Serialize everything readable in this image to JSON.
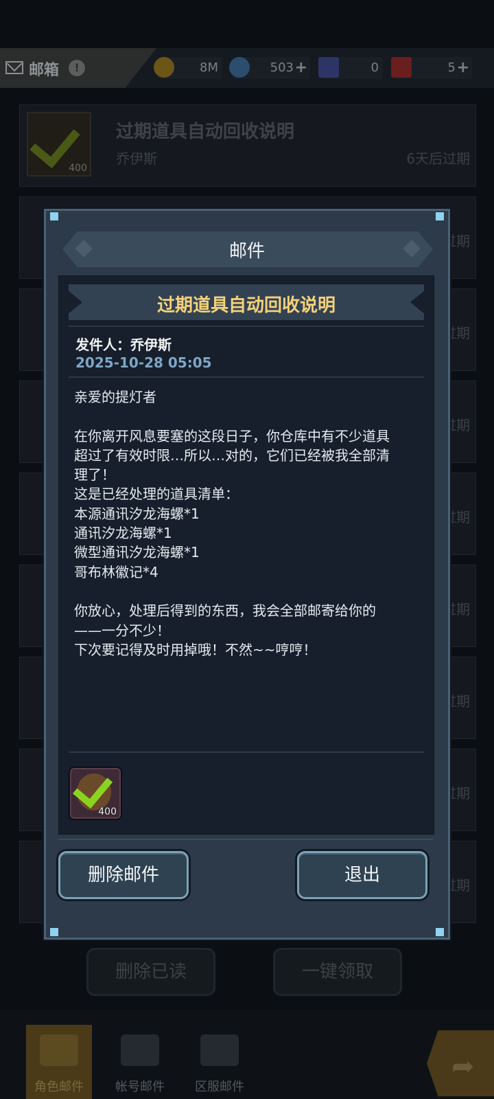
{
  "topbar": {
    "title": "邮箱",
    "help": "!",
    "resources": [
      {
        "icon": "gold-coin-icon",
        "value": "8M"
      },
      {
        "icon": "crystal-icon",
        "value": "503"
      },
      {
        "icon": "ticket-blue-icon",
        "value": "0"
      },
      {
        "icon": "ticket-red-icon",
        "value": "5"
      }
    ],
    "plus": "+"
  },
  "mail_list": [
    {
      "subject": "过期道具自动回收说明",
      "sender": "乔伊斯",
      "expire": "6天后过期",
      "qty": "400"
    },
    {
      "expire": "过期"
    },
    {
      "expire": "过期"
    },
    {
      "expire": "过期"
    },
    {
      "expire": "过期"
    },
    {
      "expire": "过期"
    },
    {
      "expire": "过期"
    },
    {
      "expire": "过期"
    },
    {
      "expire": "过期"
    }
  ],
  "bottom_buttons": {
    "delete_read": "删除已读",
    "claim_all": "一键领取"
  },
  "bottom_nav": {
    "tabs": [
      {
        "label": "角色邮件",
        "active": true
      },
      {
        "label": "帐号邮件",
        "active": false
      },
      {
        "label": "区服邮件",
        "active": false
      }
    ]
  },
  "modal": {
    "title": "邮件",
    "subject": "过期道具自动回收说明",
    "sender_line": "发件人：乔伊斯",
    "date": "2025-10-28 05:05",
    "body_lines": [
      "亲爱的提灯者",
      "",
      "在你离开风息要塞的这段日子，你仓库中有不少道具",
      "超过了有效时限…所以…对的，它们已经被我全部清",
      "理了！",
      "这是已经处理的道具清单：",
      "本源通讯汐龙海螺*1",
      "通讯汐龙海螺*1",
      "微型通讯汐龙海螺*1",
      "哥布林徽记*4",
      "",
      "你放心，处理后得到的东西，我会全部邮寄给你的",
      "——一分不少！",
      "下次要记得及时用掉哦！不然~~哼哼！"
    ],
    "attachment": {
      "icon": "checkmark-coin-icon",
      "qty": "400"
    },
    "delete_label": "删除邮件",
    "exit_label": "退出"
  }
}
